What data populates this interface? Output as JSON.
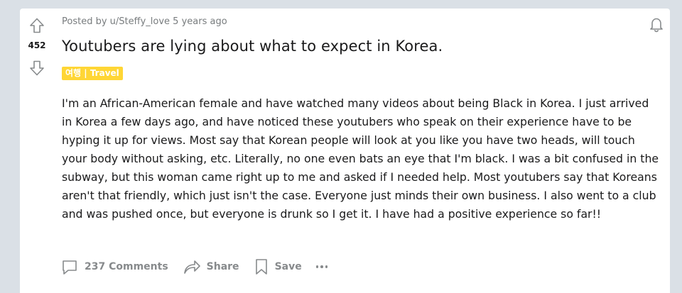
{
  "post": {
    "score": "452",
    "meta": "Posted by u/Steffy_love 5 years ago",
    "title": "Youtubers are lying about what to expect in Korea.",
    "flair": "여행 | Travel",
    "body": "I'm an African-American female and have watched many videos about being Black in Korea. I just arrived in Korea a few days ago, and have noticed these youtubers who speak on their experience have to be hyping it up for views. Most say that Korean people will look at you like you have two heads, will touch your body without asking, etc. Literally, no one even bats an eye that I'm black. I was a bit confused in the subway, but this woman came right up to me and asked if I needed help. Most youtubers say that Koreans aren't that friendly, which just isn't the case. Everyone just minds their own business. I also went to a club and was pushed once, but everyone is drunk so I get it. I have had a positive experience so far!!"
  },
  "actions": {
    "comments_label": "237 Comments",
    "share_label": "Share",
    "save_label": "Save"
  },
  "icons": {
    "upvote": "upvote-arrow-icon",
    "downvote": "downvote-arrow-icon",
    "notification": "bell-icon",
    "comments": "comment-bubble-icon",
    "share": "share-arrow-icon",
    "save": "bookmark-icon",
    "more": "more-options-icon"
  },
  "colors": {
    "page_background": "#dae0e6",
    "card_background": "#ffffff",
    "flair_background": "#ffd635",
    "muted_text": "#878a8c"
  }
}
